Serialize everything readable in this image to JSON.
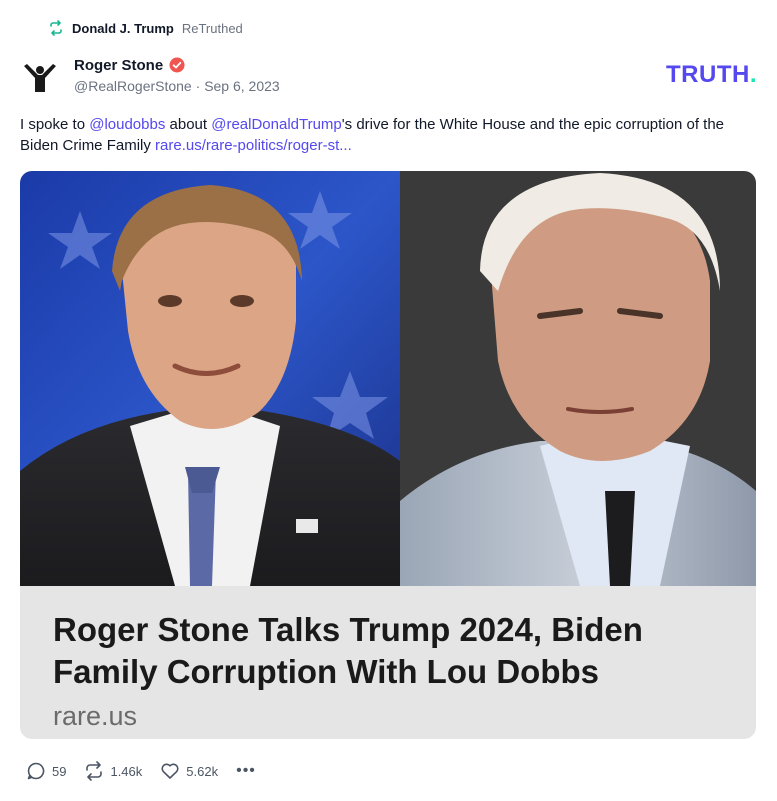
{
  "retruth": {
    "name": "Donald J. Trump",
    "action": "ReTruthed",
    "icon": "retruth-icon"
  },
  "author": {
    "name": "Roger Stone",
    "handle": "@RealRogerStone",
    "separator": "·",
    "date": "Sep 6, 2023",
    "verified_icon": "verified-badge-icon"
  },
  "brand": {
    "logo_text": "TRUTH",
    "logo_dot": ".",
    "color": "#5448ee",
    "dot_color": "#17e8b2"
  },
  "post": {
    "text_part1": "I spoke to ",
    "mention1": "@loudobbs",
    "text_part2": " about ",
    "mention2": "@realDonaldTrump",
    "text_part3": "'s drive for the White House and the epic corruption of the Biden Crime Family ",
    "link": "rare.us/rare-politics/roger-st..."
  },
  "link_card": {
    "headline": "Roger Stone Talks Trump 2024, Biden Family Corruption With Lou Dobbs",
    "domain": "rare.us"
  },
  "actions": {
    "replies": "59",
    "retruths": "1.46k",
    "likes": "5.62k",
    "more": "•••"
  },
  "colors": {
    "accent": "#5448ee",
    "verified": "#f0554f",
    "text_muted": "#6b7280"
  }
}
